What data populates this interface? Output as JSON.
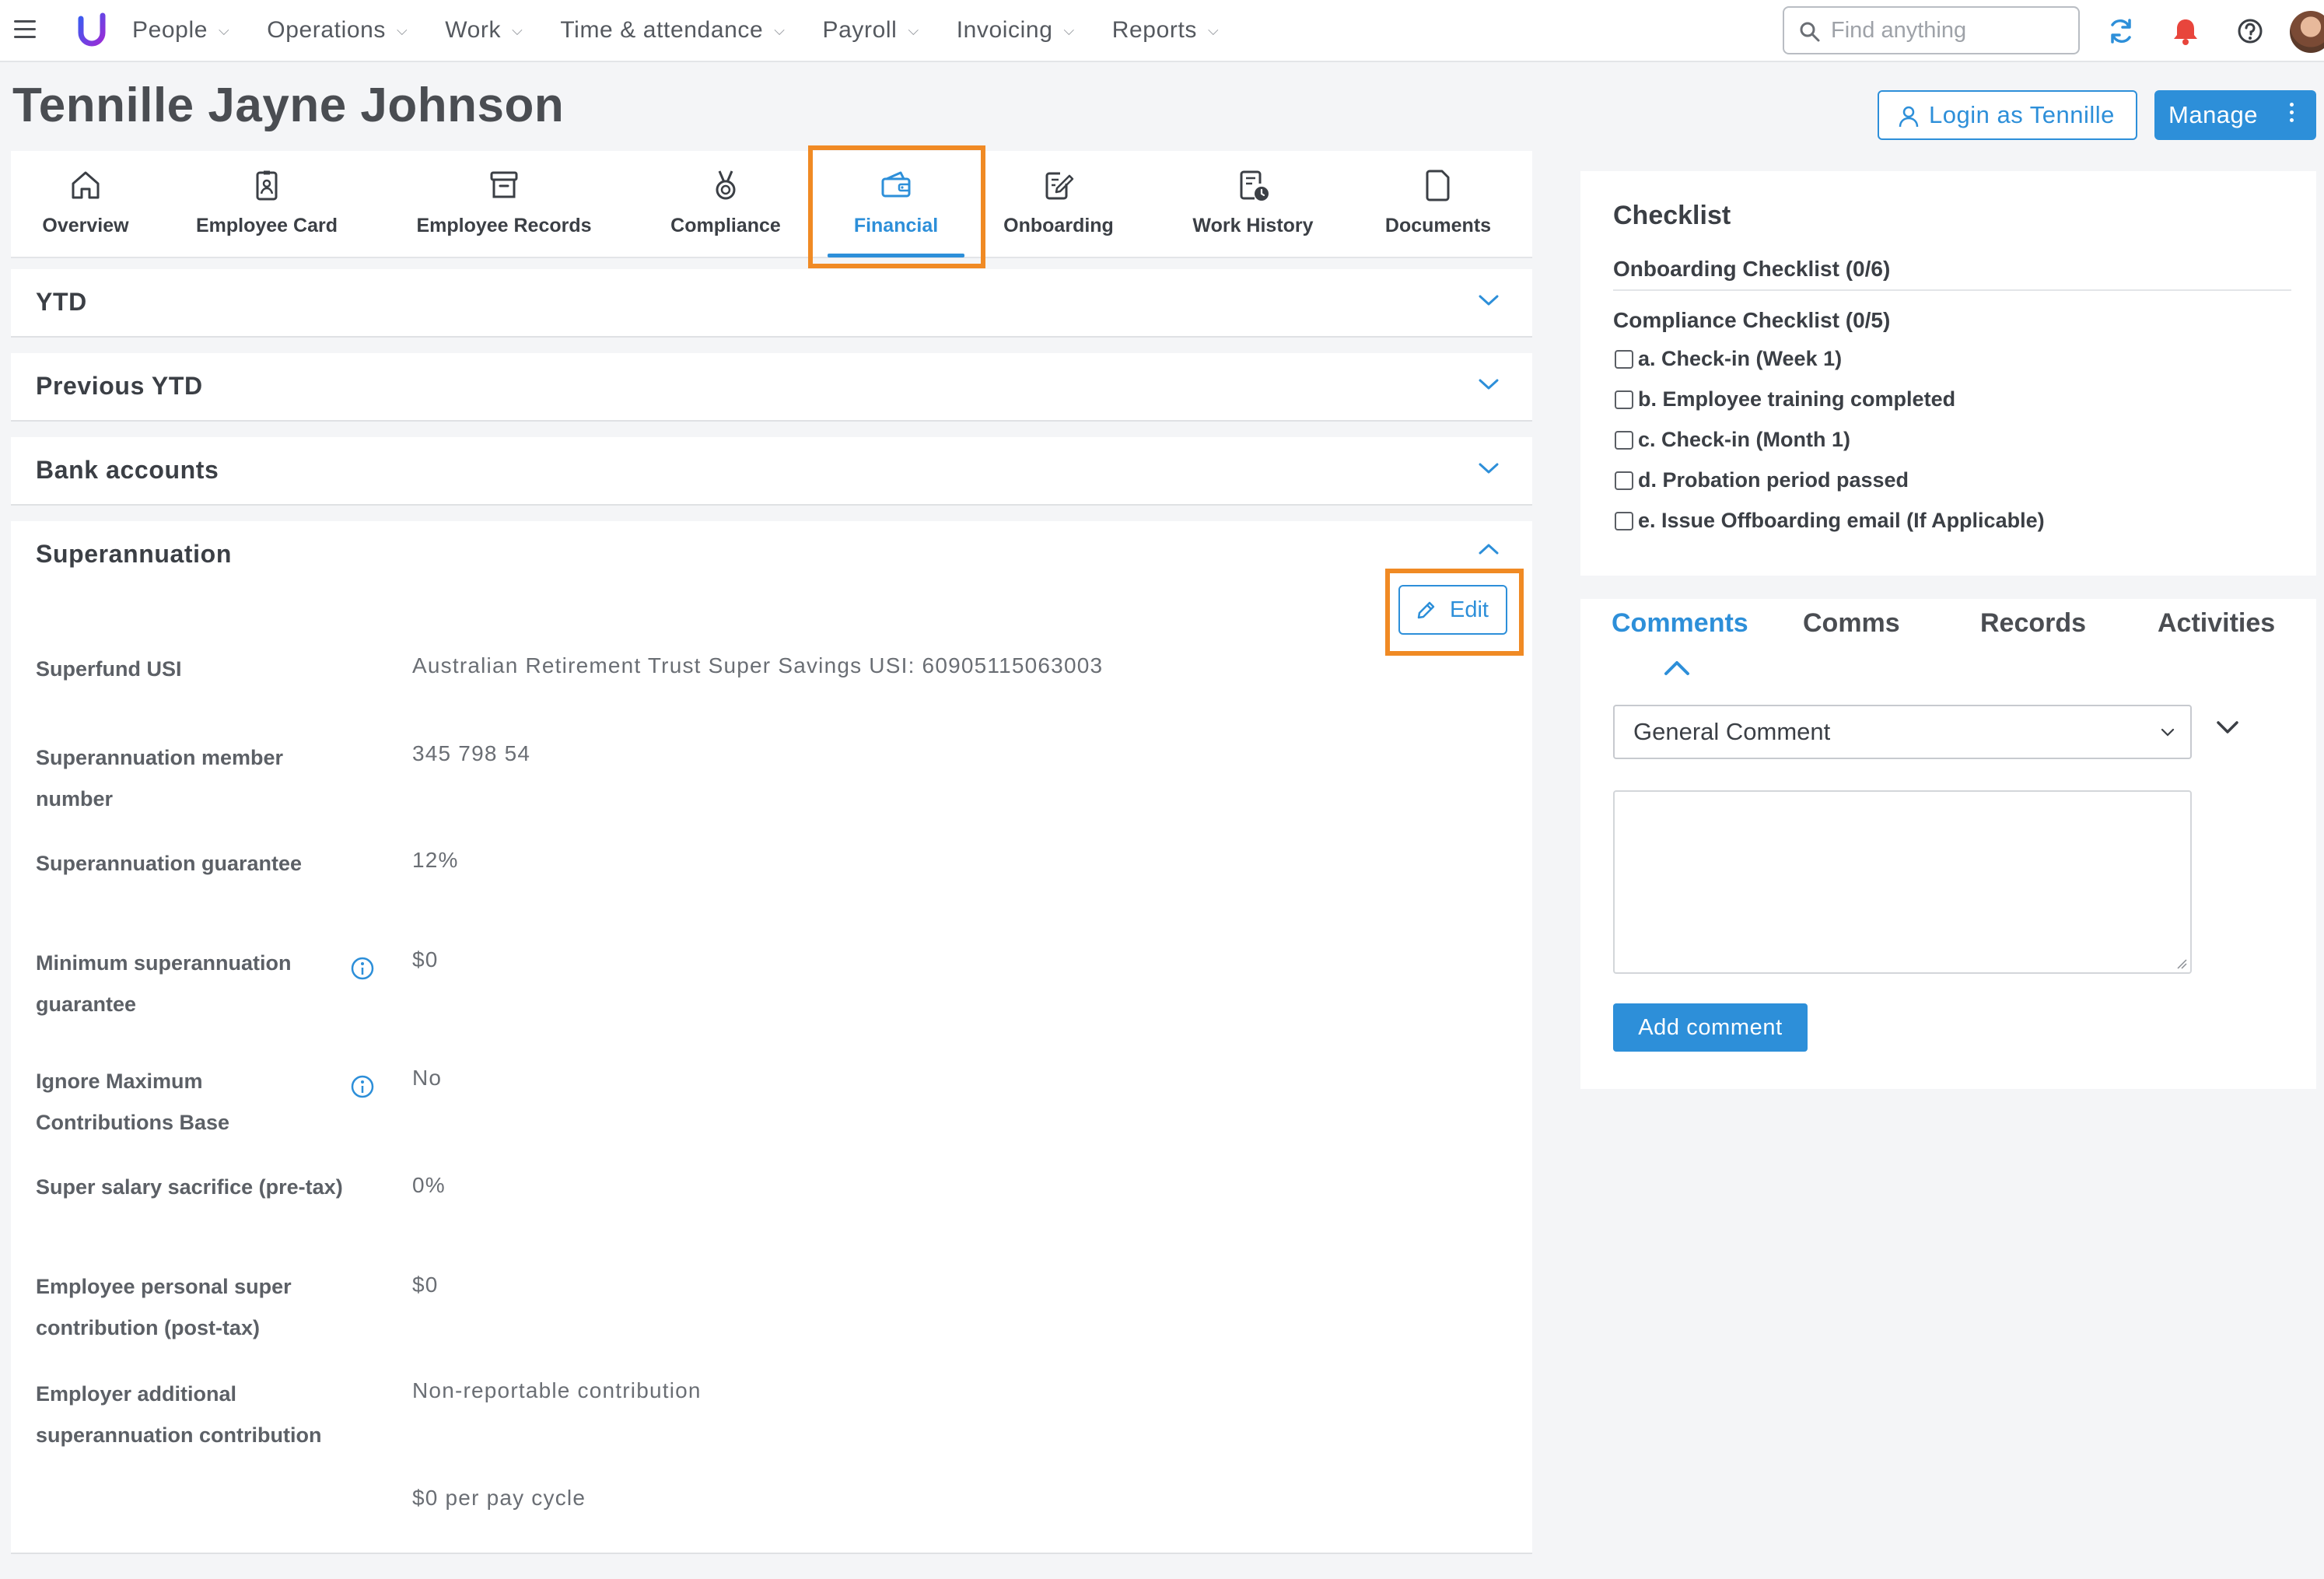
{
  "topbar": {
    "nav": [
      {
        "label": "People"
      },
      {
        "label": "Operations"
      },
      {
        "label": "Work"
      },
      {
        "label": "Time & attendance"
      },
      {
        "label": "Payroll"
      },
      {
        "label": "Invoicing"
      },
      {
        "label": "Reports"
      }
    ],
    "search_placeholder": "Find anything",
    "icons": [
      "menu-icon",
      "logo",
      "search-icon",
      "sync-icon",
      "bell-icon",
      "help-icon",
      "avatar"
    ]
  },
  "header": {
    "title": "Tennille Jayne Johnson",
    "login_label": "Login as Tennille",
    "manage_label": "Manage"
  },
  "tabs": [
    {
      "label": "Overview",
      "icon": "home-icon"
    },
    {
      "label": "Employee Card",
      "icon": "id-badge-icon"
    },
    {
      "label": "Employee Records",
      "icon": "archive-icon"
    },
    {
      "label": "Compliance",
      "icon": "medal-icon"
    },
    {
      "label": "Financial",
      "icon": "wallet-icon",
      "active": true
    },
    {
      "label": "Onboarding",
      "icon": "edit-document-icon"
    },
    {
      "label": "Work History",
      "icon": "history-document-icon"
    },
    {
      "label": "Documents",
      "icon": "document-icon"
    }
  ],
  "panels": {
    "ytd": "YTD",
    "previous_ytd": "Previous YTD",
    "bank_accounts": "Bank accounts",
    "superannuation": "Superannuation"
  },
  "superannuation": {
    "edit_label": "Edit",
    "fields": [
      {
        "label": "Superfund USI",
        "value": "Australian Retirement Trust Super Savings USI: 60905115063003"
      },
      {
        "label": "Superannuation member number",
        "value": "345 798 54"
      },
      {
        "label": "Superannuation guarantee",
        "value": "12%"
      },
      {
        "label": "Minimum superannuation guarantee",
        "value": "$0",
        "info": true
      },
      {
        "label": "Ignore Maximum Contributions Base",
        "value": "No",
        "info": true
      },
      {
        "label": "Super salary sacrifice (pre-tax)",
        "value": "0%"
      },
      {
        "label": "Employee personal super contribution (post-tax)",
        "value": "$0"
      },
      {
        "label": "Employer additional superannuation contribution",
        "value": "Non-reportable contribution",
        "value2": "$0 per pay cycle"
      }
    ]
  },
  "checklist": {
    "title": "Checklist",
    "onboarding": "Onboarding Checklist (0/6)",
    "compliance": "Compliance Checklist (0/5)",
    "items": [
      "a. Check-in (Week 1)",
      "b. Employee training completed",
      "c. Check-in (Month 1)",
      "d. Probation period passed",
      "e. Issue Offboarding email (If Applicable)"
    ]
  },
  "comments": {
    "tabs": [
      "Comments",
      "Comms",
      "Records",
      "Activities"
    ],
    "select_value": "General Comment",
    "add_label": "Add comment"
  },
  "colors": {
    "accent": "#2d8fd9",
    "highlight": "#f08a24",
    "notification": "#e8453c"
  }
}
